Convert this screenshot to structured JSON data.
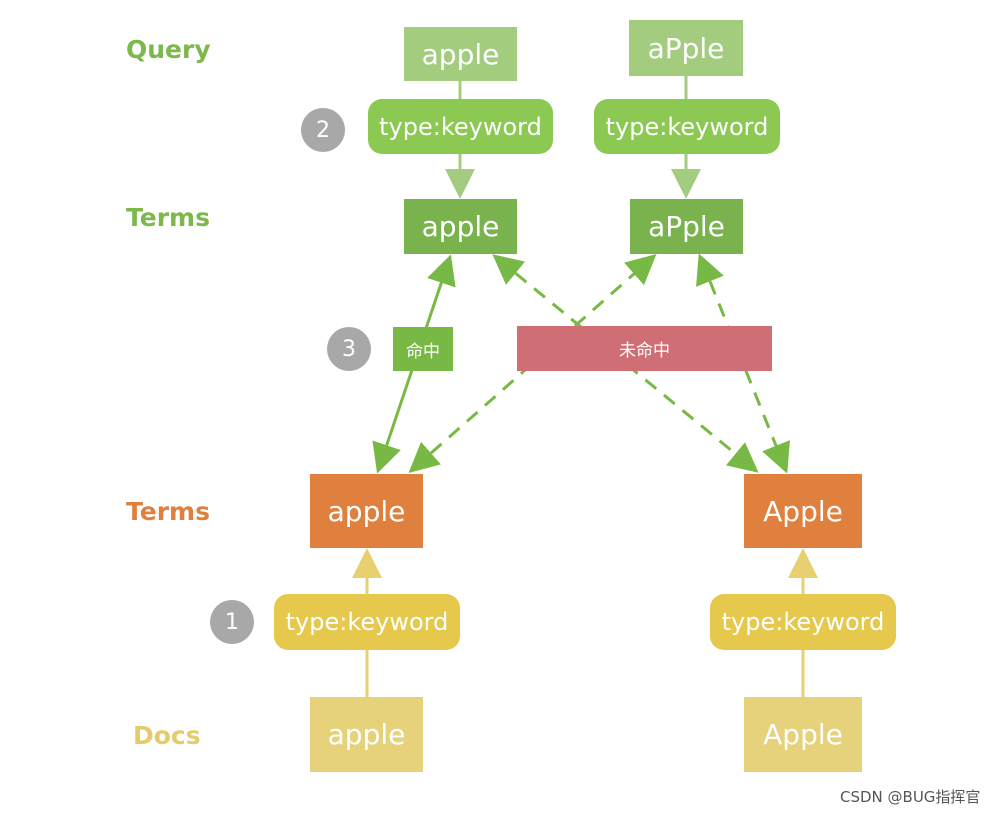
{
  "rows": {
    "query": "Query",
    "terms_query": "Terms",
    "terms_doc": "Terms",
    "docs": "Docs"
  },
  "query": {
    "left": "apple",
    "right": "aPple"
  },
  "query_type": {
    "left": "type:keyword",
    "right": "type:keyword"
  },
  "query_terms": {
    "left": "apple",
    "right": "aPple"
  },
  "doc_terms": {
    "left": "apple",
    "right": "Apple"
  },
  "doc_type": {
    "left": "type:keyword",
    "right": "type:keyword"
  },
  "docs": {
    "left": "apple",
    "right": "Apple"
  },
  "steps": {
    "one": "1",
    "two": "2",
    "three": "3"
  },
  "match": {
    "hit": "命中",
    "miss": "未命中"
  },
  "watermark": "CSDN @BUG指挥官",
  "colors": {
    "green_label": "#7cb84a",
    "query_box": "#a3cc7f",
    "query_pill": "#8bc953",
    "query_terms": "#7ab24e",
    "hit": "#78b946",
    "miss": "#cf6f75",
    "orange": "#e0803f",
    "yellow_pill": "#e5c84c",
    "doc_box": "#e6d27a",
    "doc_label": "#e5cc6a",
    "step": "#a8a8a8"
  }
}
